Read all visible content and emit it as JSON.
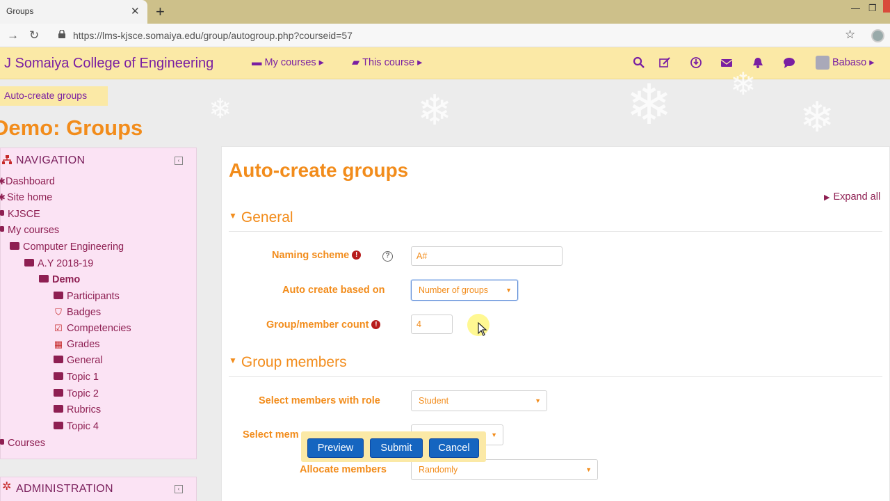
{
  "browser": {
    "tab_title": "Groups",
    "tab_close": "✕",
    "new_tab": "+",
    "url": "https://lms-kjsce.somaiya.edu/group/autogroup.php?courseid=57",
    "minimize": "—",
    "restore": "❐"
  },
  "navbar": {
    "brand": "J Somaiya College of Engineering",
    "my_courses": "My courses",
    "this_course": "This course",
    "user_name": "Babaso",
    "menu_caret": "▸"
  },
  "breadcrumb": "Auto-create groups",
  "page_title": "Demo: Groups",
  "navigation": {
    "title": "NAVIGATION",
    "items": [
      {
        "label": "Dashboard"
      },
      {
        "label": "Site home"
      },
      {
        "label": "KJSCE"
      },
      {
        "label": "My courses"
      },
      {
        "label": "Computer Engineering"
      },
      {
        "label": "A.Y 2018-19"
      },
      {
        "label": "Demo"
      },
      {
        "label": "Participants"
      },
      {
        "label": "Badges"
      },
      {
        "label": "Competencies"
      },
      {
        "label": "Grades"
      },
      {
        "label": "General"
      },
      {
        "label": "Topic 1"
      },
      {
        "label": "Topic 2"
      },
      {
        "label": "Rubrics"
      },
      {
        "label": "Topic 4"
      },
      {
        "label": "Courses"
      }
    ]
  },
  "administration": {
    "title": "ADMINISTRATION"
  },
  "form": {
    "title": "Auto-create groups",
    "expand_all": "Expand all",
    "sections": {
      "general": "General",
      "group_members": "Group members"
    },
    "fields": {
      "naming_scheme": {
        "label": "Naming scheme",
        "value": "A#"
      },
      "auto_create": {
        "label": "Auto create based on",
        "value": "Number of groups"
      },
      "count": {
        "label": "Group/member count",
        "value": "4"
      },
      "select_role": {
        "label": "Select members with role",
        "value": "Student"
      },
      "select_members": {
        "label": "Select mem"
      },
      "allocate": {
        "label": "Allocate members",
        "value": "Randomly"
      }
    }
  },
  "actions": {
    "preview": "Preview",
    "submit": "Submit",
    "cancel": "Cancel"
  },
  "colors": {
    "accent": "#f28c1b",
    "brand_purple": "#7a1fa2",
    "nav_link": "#8e1f52",
    "navbar_bg": "#fbe9a6",
    "nav_block_bg": "#fbe3f4",
    "button_blue": "#1565c0"
  }
}
